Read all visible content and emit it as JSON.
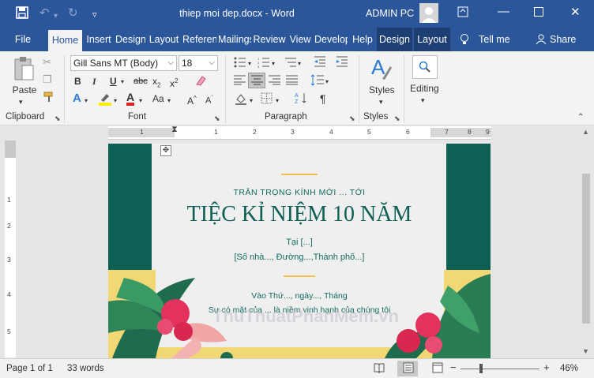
{
  "titlebar": {
    "doc_title": "thiep moi dep.docx - Word",
    "user_name": "ADMIN PC"
  },
  "tabs": [
    {
      "label": "File"
    },
    {
      "label": "Home"
    },
    {
      "label": "Insert"
    },
    {
      "label": "Design"
    },
    {
      "label": "Layout"
    },
    {
      "label": "References"
    },
    {
      "label": "Mailings"
    },
    {
      "label": "Review"
    },
    {
      "label": "View"
    },
    {
      "label": "Developer"
    },
    {
      "label": "Help"
    },
    {
      "label": "Design"
    },
    {
      "label": "Layout"
    }
  ],
  "tellme": "Tell me",
  "share": "Share",
  "ribbon": {
    "clipboard": {
      "paste_label": "Paste",
      "group_label": "Clipboard"
    },
    "font": {
      "name": "Gill Sans MT (Body)",
      "size": "18",
      "group_label": "Font"
    },
    "paragraph": {
      "group_label": "Paragraph"
    },
    "styles": {
      "label": "Styles",
      "group_label": "Styles"
    },
    "editing": {
      "label": "Editing"
    }
  },
  "ruler": {
    "h": [
      "1",
      "1",
      "2",
      "3",
      "4",
      "5",
      "6",
      "7",
      "8",
      "9"
    ],
    "v": [
      "1",
      "2",
      "3",
      "4",
      "5"
    ]
  },
  "document": {
    "line1": "TRÂN TRỌNG KÍNH MỜI ... TỚI",
    "heading": "TIỆC KỈ NIỆM 10 NĂM",
    "place": "Tại [...]",
    "address": "[Số nhà..., Đường...,Thành phố...]",
    "date": "Vào Thứ..., ngày..., Tháng",
    "presence": "Sự có mặt của ... là niềm vinh hạnh của chúng tôi",
    "watermark": "ThuThuatPhanMem.vn"
  },
  "status": {
    "page": "Page 1 of 1",
    "words": "33 words",
    "zoom": "46%"
  },
  "colors": {
    "word_blue": "#2b579a",
    "teal": "#0e5f54",
    "gold": "#f0c24b",
    "text_teal": "#12695e"
  }
}
